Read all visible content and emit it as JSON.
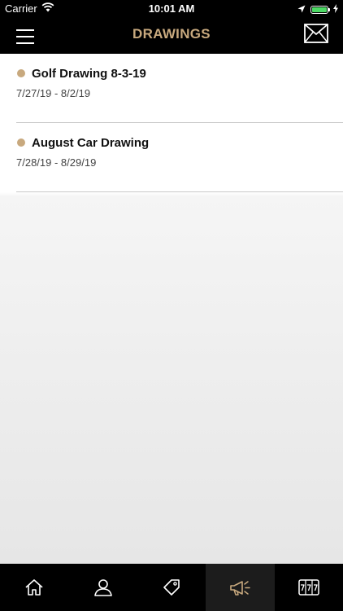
{
  "status_bar": {
    "carrier": "Carrier",
    "time": "10:01 AM",
    "battery_level": 1.0
  },
  "header": {
    "title": "DRAWINGS",
    "menu_icon": "hamburger-menu-icon",
    "mail_icon": "envelope-icon"
  },
  "drawings": [
    {
      "title": "Golf Drawing 8-3-19",
      "dates": "7/27/19 - 8/2/19"
    },
    {
      "title": "August Car Drawing",
      "dates": "7/28/19 - 8/29/19"
    }
  ],
  "tab_bar": {
    "tabs": [
      {
        "icon": "home-icon",
        "active": false
      },
      {
        "icon": "person-icon",
        "active": false
      },
      {
        "icon": "tag-icon",
        "active": false
      },
      {
        "icon": "megaphone-icon",
        "active": true
      },
      {
        "icon": "slot-machine-icon",
        "active": false
      }
    ]
  },
  "colors": {
    "accent": "#c8a97e",
    "bar_background": "#000000",
    "icon_inactive": "#ffffff",
    "separator": "#c8c8c8"
  }
}
